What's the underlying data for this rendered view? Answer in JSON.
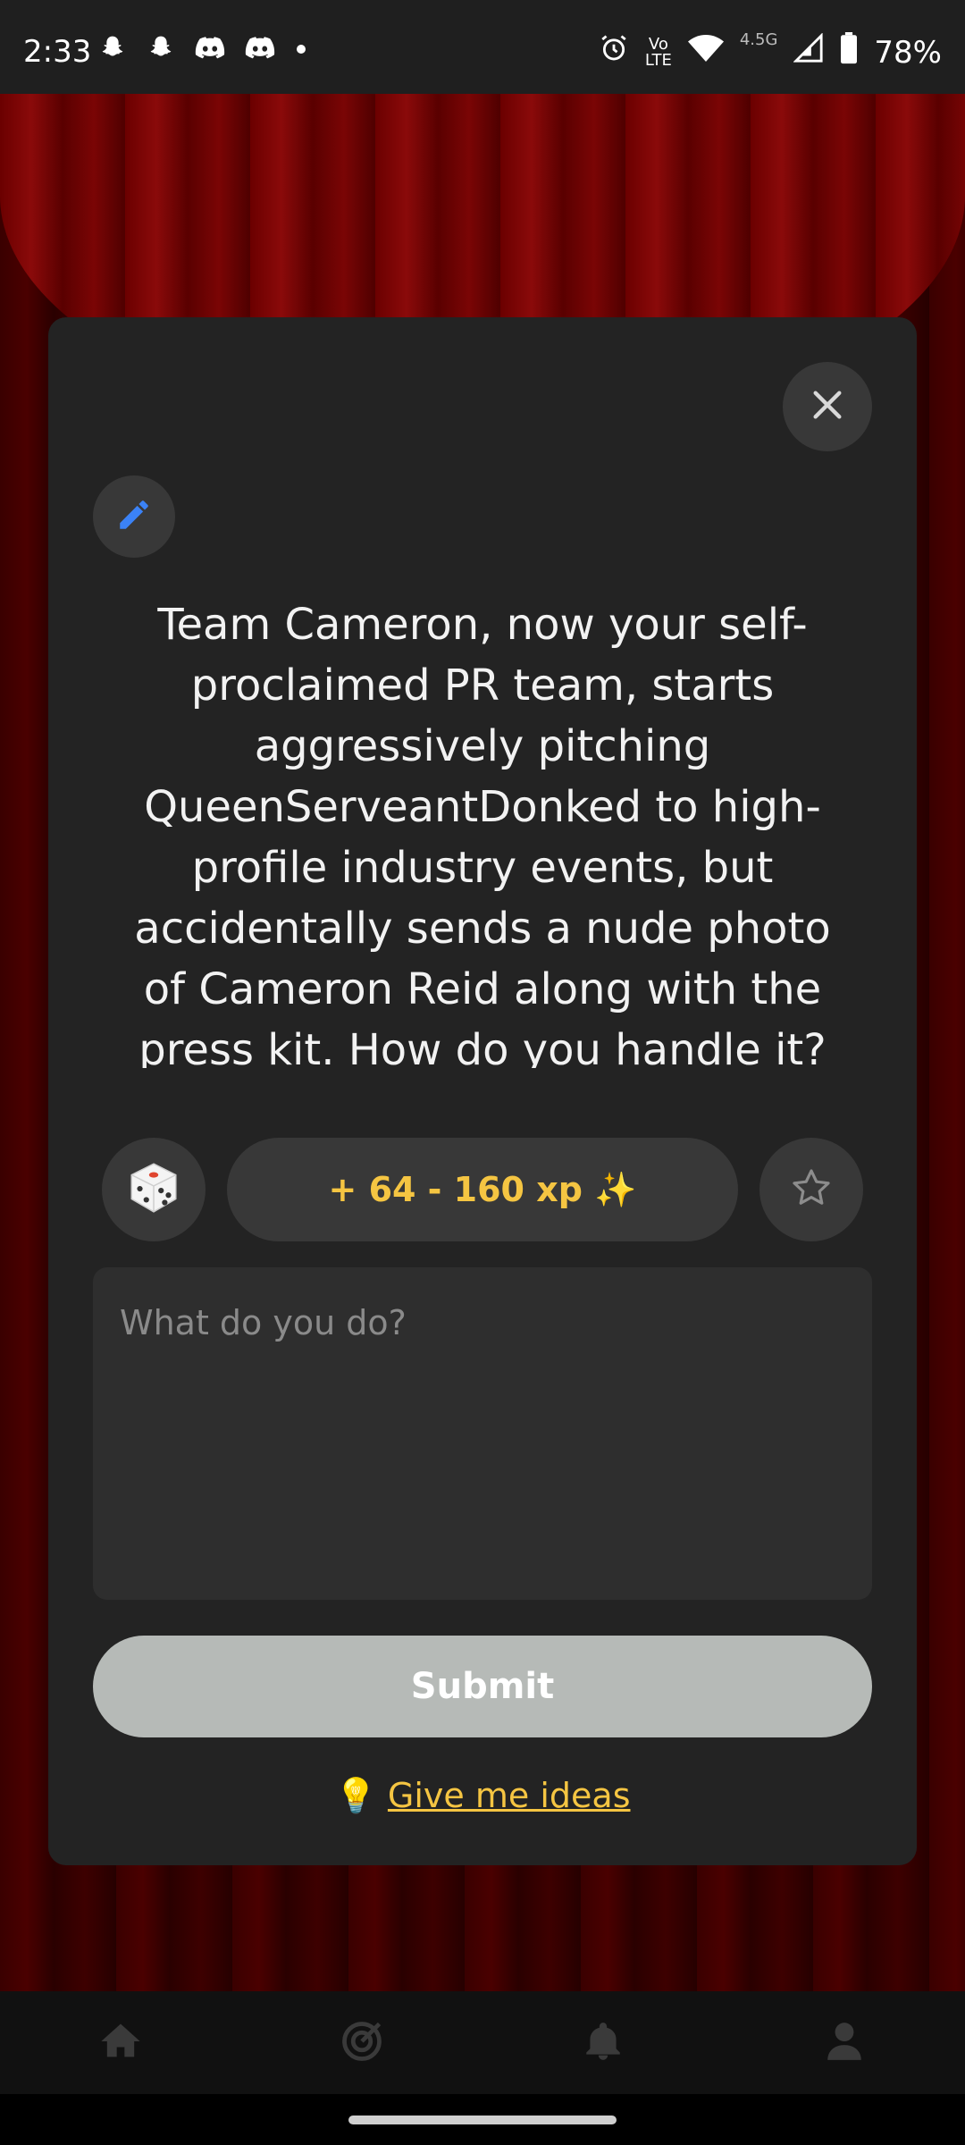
{
  "status_bar": {
    "time": "2:33",
    "left_icons": [
      "snapchat-icon",
      "snapchat-icon",
      "discord-icon",
      "discord-icon",
      "dot-icon"
    ],
    "network_label_top": "Vo",
    "network_label_bottom": "LTE",
    "network_speed": "4.5G",
    "battery": "78%"
  },
  "modal": {
    "prompt": "Team Cameron, now your self-proclaimed PR team, starts aggressively pitching QueenServeantDonked to high-profile industry events, but accidentally sends a nude photo of Cameron Reid along with the press kit. How do you handle it?",
    "xp_label": "+ 64 - 160 xp ✨",
    "answer_placeholder": "What do you do?",
    "submit_label": "Submit",
    "ideas_emoji": "💡",
    "ideas_label": "Give me ideas"
  },
  "colors": {
    "accent": "#f5c542",
    "modal_bg": "#232323",
    "submit_bg": "#b6bab7",
    "edit_icon": "#3b82f6"
  },
  "bottom_nav": [
    "home-icon",
    "target-icon",
    "bell-icon",
    "profile-icon"
  ]
}
